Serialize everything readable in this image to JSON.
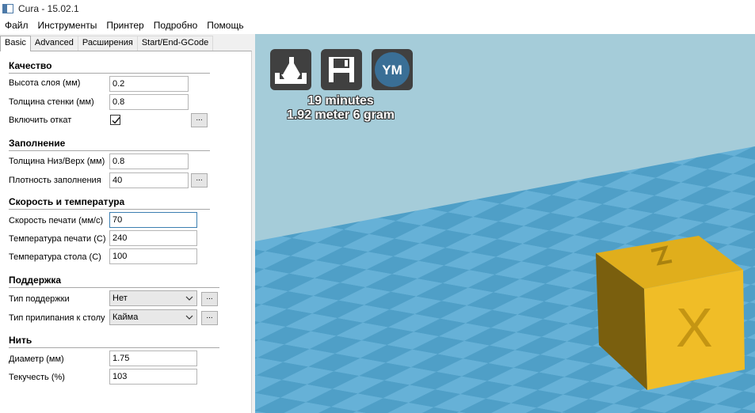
{
  "window": {
    "title": "Cura - 15.02.1"
  },
  "menu": [
    "Файл",
    "Инструменты",
    "Принтер",
    "Подробно",
    "Помощь"
  ],
  "tabs": [
    "Basic",
    "Advanced",
    "Расширения",
    "Start/End-GCode"
  ],
  "sections": {
    "quality": {
      "title": "Качество",
      "layer_height_label": "Высота слоя (мм)",
      "layer_height": "0.2",
      "shell_label": "Толщина стенки (мм)",
      "shell": "0.8",
      "retraction_label": "Включить откат",
      "retraction_checked": true
    },
    "fill": {
      "title": "Заполнение",
      "bottom_top_label": "Толщина Низ/Верх (мм)",
      "bottom_top": "0.8",
      "density_label": "Плотность заполнения",
      "density": "40"
    },
    "speed": {
      "title": "Скорость и температура",
      "print_speed_label": "Скорость печати (мм/с)",
      "print_speed": "70",
      "print_temp_label": "Температура печати (С)",
      "print_temp": "240",
      "bed_temp_label": "Температура стола (С)",
      "bed_temp": "100"
    },
    "support": {
      "title": "Поддержка",
      "support_type_label": "Тип поддержки",
      "support_type": "Нет",
      "adhesion_label": "Тип прилипания к столу",
      "adhesion": "Кайма"
    },
    "filament": {
      "title": "Нить",
      "diameter_label": "Диаметр (мм)",
      "diameter": "1.75",
      "flow_label": "Текучесть (%)",
      "flow": "103"
    }
  },
  "dots_label": "...",
  "viewport": {
    "print_time": "19 minutes",
    "print_material": "1.92 meter 6 gram",
    "ym_label": "YM",
    "cube_label": "X"
  },
  "colors": {
    "sky": "#a5ccd9",
    "plate_light": "#6fb6da",
    "plate_dark": "#5aa3c8",
    "cube": "#e8b520"
  }
}
